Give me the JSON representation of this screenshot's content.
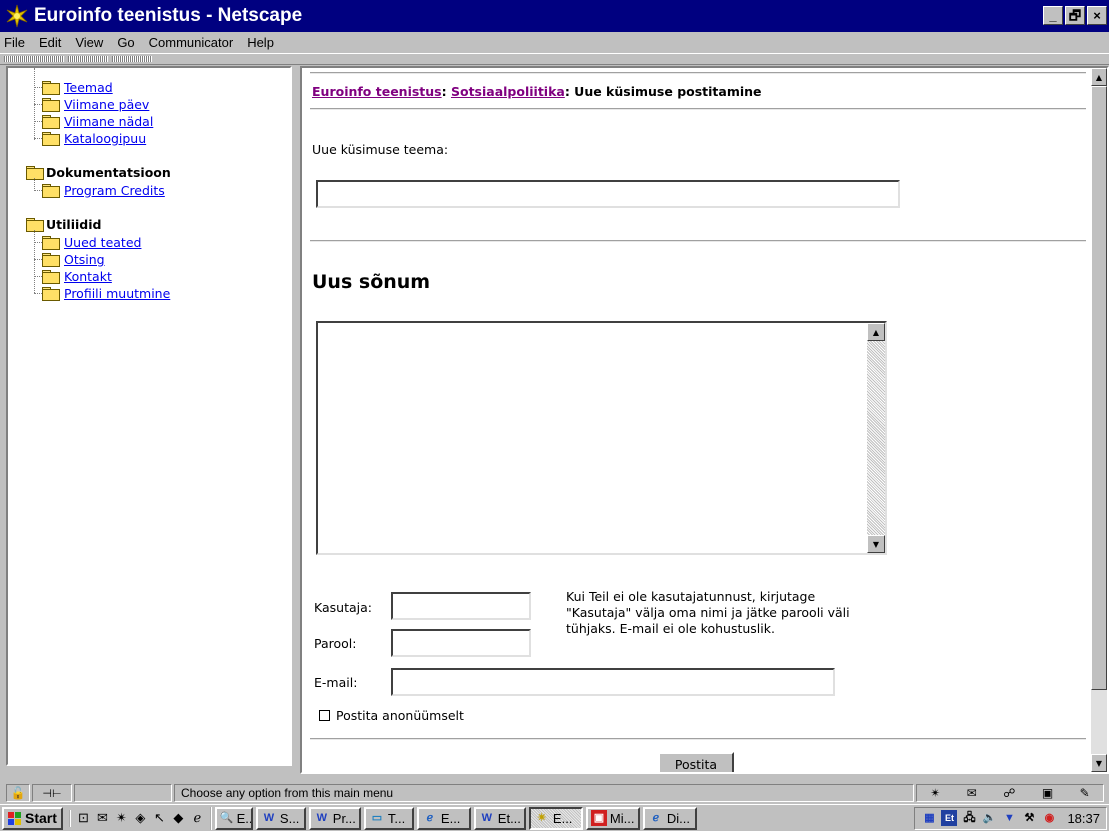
{
  "window": {
    "title": "Euroinfo teenistus - Netscape",
    "controls": [
      "_",
      "🗗",
      "×"
    ]
  },
  "menu": [
    {
      "label": "File",
      "mnemonic": "F"
    },
    {
      "label": "Edit",
      "mnemonic": "E"
    },
    {
      "label": "View",
      "mnemonic": "V"
    },
    {
      "label": "Go",
      "mnemonic": "G"
    },
    {
      "label": "Communicator",
      "mnemonic": "C"
    },
    {
      "label": "Help",
      "mnemonic": "H"
    }
  ],
  "sidebar": {
    "links1": [
      "Teemad",
      "Viimane päev",
      "Viimane nädal",
      "Kataloogipuu"
    ],
    "group2": "Dokumentatsioon",
    "links2": [
      "Program Credits"
    ],
    "group3": "Utiliidid",
    "links3": [
      "Uued teated",
      "Otsing",
      "Kontakt",
      "Profiili muutmine"
    ]
  },
  "breadcrumb": {
    "link1": "Euroinfo teenistus",
    "sep": ": ",
    "link2": "Sotsiaalpoliitika",
    "current": ": Uue küsimuse postitamine"
  },
  "form": {
    "subject_label": "Uue küsimuse teema:",
    "subject_value": "",
    "message_heading": "Uus sõnum",
    "message_value": "",
    "user_label": "Kasutaja:",
    "password_label": "Parool:",
    "email_label": "E-mail:",
    "hint": "Kui Teil ei ole kasutajatunnust, kirjutage \"Kasutaja\" välja oma nimi ja jätke parooli väli tühjaks. E-mail ei ole kohustuslik.",
    "anonymous_label": "Postita anonüümselt",
    "submit_label": "Postita"
  },
  "status": {
    "text": "Choose any option from this main menu"
  },
  "taskbar": {
    "start_label": "Start",
    "tasks": [
      "E...",
      "S...",
      "Pr...",
      "T...",
      "E...",
      "Et...",
      "E...",
      "Mi...",
      "Di..."
    ],
    "clock": "18:37"
  }
}
